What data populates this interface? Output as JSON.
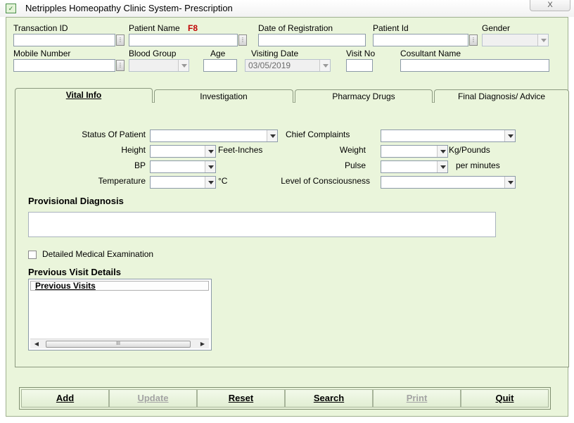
{
  "window": {
    "title": "Netripples Homeopathy Clinic System- Prescription",
    "close_label": "X"
  },
  "header": {
    "transaction_id": {
      "label": "Transaction ID",
      "value": ""
    },
    "patient_name": {
      "label": "Patient Name",
      "hotkey": "F8",
      "value": ""
    },
    "date_of_registration": {
      "label": "Date of Registration",
      "value": ""
    },
    "patient_id": {
      "label": "Patient Id",
      "value": ""
    },
    "gender": {
      "label": "Gender",
      "value": ""
    },
    "mobile_number": {
      "label": "Mobile Number",
      "value": ""
    },
    "blood_group": {
      "label": "Blood Group",
      "value": ""
    },
    "age": {
      "label": "Age",
      "value": ""
    },
    "visiting_date": {
      "label": "Visiting Date",
      "value": "03/05/2019"
    },
    "visit_no": {
      "label": "Visit No",
      "value": ""
    },
    "consultant_name": {
      "label": "Cosultant Name",
      "value": ""
    }
  },
  "tabs": [
    {
      "label": "Vital Info",
      "active": true
    },
    {
      "label": "Investigation",
      "active": false
    },
    {
      "label": "Pharmacy Drugs",
      "active": false
    },
    {
      "label": "Final Diagnosis/ Advice",
      "active": false
    }
  ],
  "vital_info": {
    "status_of_patient": "Status Of Patient",
    "chief_complaints": "Chief Complaints",
    "height": "Height",
    "height_unit": "Feet-Inches",
    "weight": "Weight",
    "weight_unit": "Kg/Pounds",
    "bp": "BP",
    "pulse": "Pulse",
    "pulse_unit": "per minutes",
    "temperature": "Temperature",
    "temperature_unit": "°C",
    "level_of_consciousness": "Level of Consciousness",
    "provisional_diagnosis": "Provisional Diagnosis",
    "detailed_exam": "Detailed Medical  Examination",
    "previous_visit_details": "Previous Visit Details",
    "previous_visits_header": "Previous Visits"
  },
  "buttons": [
    {
      "label": "Add",
      "enabled": true
    },
    {
      "label": "Update",
      "enabled": false
    },
    {
      "label": "Reset",
      "enabled": true
    },
    {
      "label": "Search",
      "enabled": true
    },
    {
      "label": "Print",
      "enabled": false
    },
    {
      "label": "Quit",
      "enabled": true
    }
  ],
  "colors": {
    "form_background": "#eaf5db",
    "hotkey": "#c00000"
  }
}
